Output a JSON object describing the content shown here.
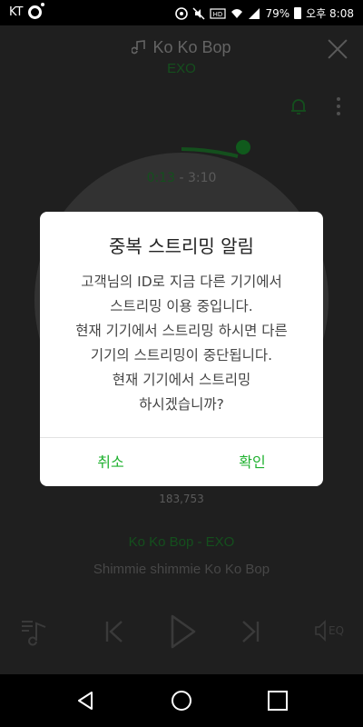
{
  "status_bar": {
    "carrier": "KT",
    "battery_percent": "79%",
    "time": "오후 8:08",
    "icons": [
      "o-ring-icon",
      "sync-icon",
      "mute-icon",
      "hd-icon",
      "wifi-icon",
      "signal-icon",
      "battery-icon"
    ]
  },
  "player": {
    "song_title": "Ko Ko Bop",
    "artist": "EXO",
    "current_time": "0:13",
    "separator": "-",
    "total_time": "3:10",
    "likes": "183,753",
    "track_info": "Ko Ko Bop - EXO",
    "lyrics": "Shimmie shimmie Ko Ko Bop",
    "eq_label": "EQ",
    "progress": 0.068
  },
  "dialog": {
    "title": "중복 스트리밍 알림",
    "lines": [
      "고객님의 ID로 지금 다른 기기에서",
      "스트리밍 이용 중입니다.",
      "현재 기기에서 스트리밍 하시면 다른",
      "기기의 스트리밍이 중단됩니다.",
      "현재 기기에서 스트리밍",
      "하시겠습니까?"
    ],
    "cancel_label": "취소",
    "confirm_label": "확인"
  },
  "colors": {
    "accent": "#1fb12f",
    "accent_dim": "#1f7a2d",
    "dialog_bg": "#ffffff"
  }
}
